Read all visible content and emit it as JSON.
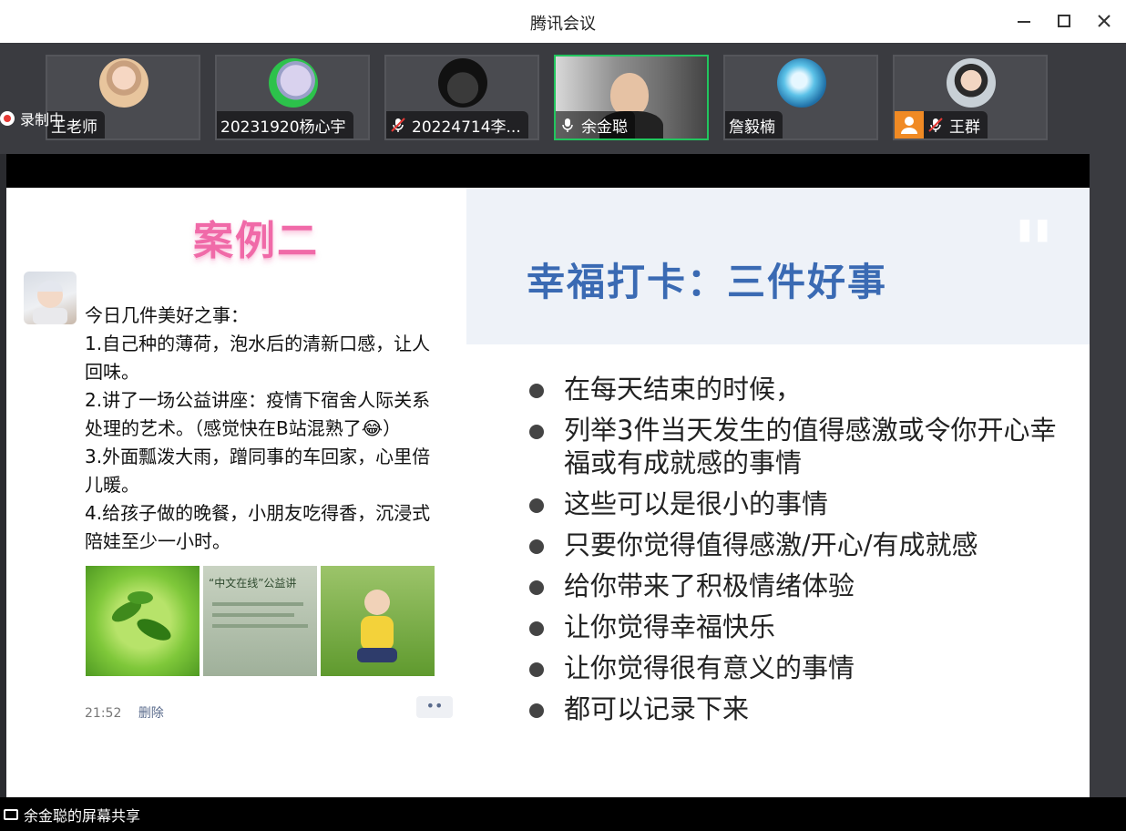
{
  "window": {
    "title": "腾讯会议"
  },
  "recording": {
    "label": "录制中"
  },
  "participants": [
    {
      "name": "王老师",
      "muted": false,
      "mic": "none"
    },
    {
      "name": "20231920杨心宇",
      "muted": false,
      "mic": "none"
    },
    {
      "name": "20224714李...",
      "muted": true,
      "mic": "muted"
    },
    {
      "name": "余金聪",
      "muted": false,
      "mic": "on",
      "speaking": true
    },
    {
      "name": "詹毅楠",
      "muted": false,
      "mic": "none"
    },
    {
      "name": "王群",
      "muted": true,
      "mic": "muted",
      "host_badge": true
    }
  ],
  "slide": {
    "case_title": "案例二",
    "post_lines": [
      "今日几件美好之事：",
      "1.自己种的薄荷，泡水后的清新口感，让人",
      "回味。",
      "2.讲了一场公益讲座：疫情下宿舍人际关系",
      "处理的艺术。（感觉快在B站混熟了😂）",
      "3.外面瓢泼大雨，蹭同事的车回家，心里倍",
      "儿暖。",
      "4.给孩子做的晚餐，小朋友吃得香，沉浸式",
      "陪娃至少一小时。"
    ],
    "poster_text": "“中文在线”公益讲",
    "time": "21:52",
    "delete_label": "删除",
    "more_label": "••",
    "title": "幸福打卡：三件好事",
    "quote_mark": "\"",
    "bullets": [
      "在每天结束的时候，",
      "列举3件当天发生的值得感激或令你开心幸福或有成就感的事情",
      "这些可以是很小的事情",
      "只要你觉得值得感激/开心/有成就感",
      "给你带来了积极情绪体验",
      "让你觉得幸福快乐",
      "让你觉得很有意义的事情",
      "都可以记录下来"
    ]
  },
  "share_status": "余金聪的屏幕共享",
  "colors": {
    "accent_title": "#3a6ab3",
    "case_pink": "#f06aa8",
    "speaking_border": "#22c55e"
  }
}
